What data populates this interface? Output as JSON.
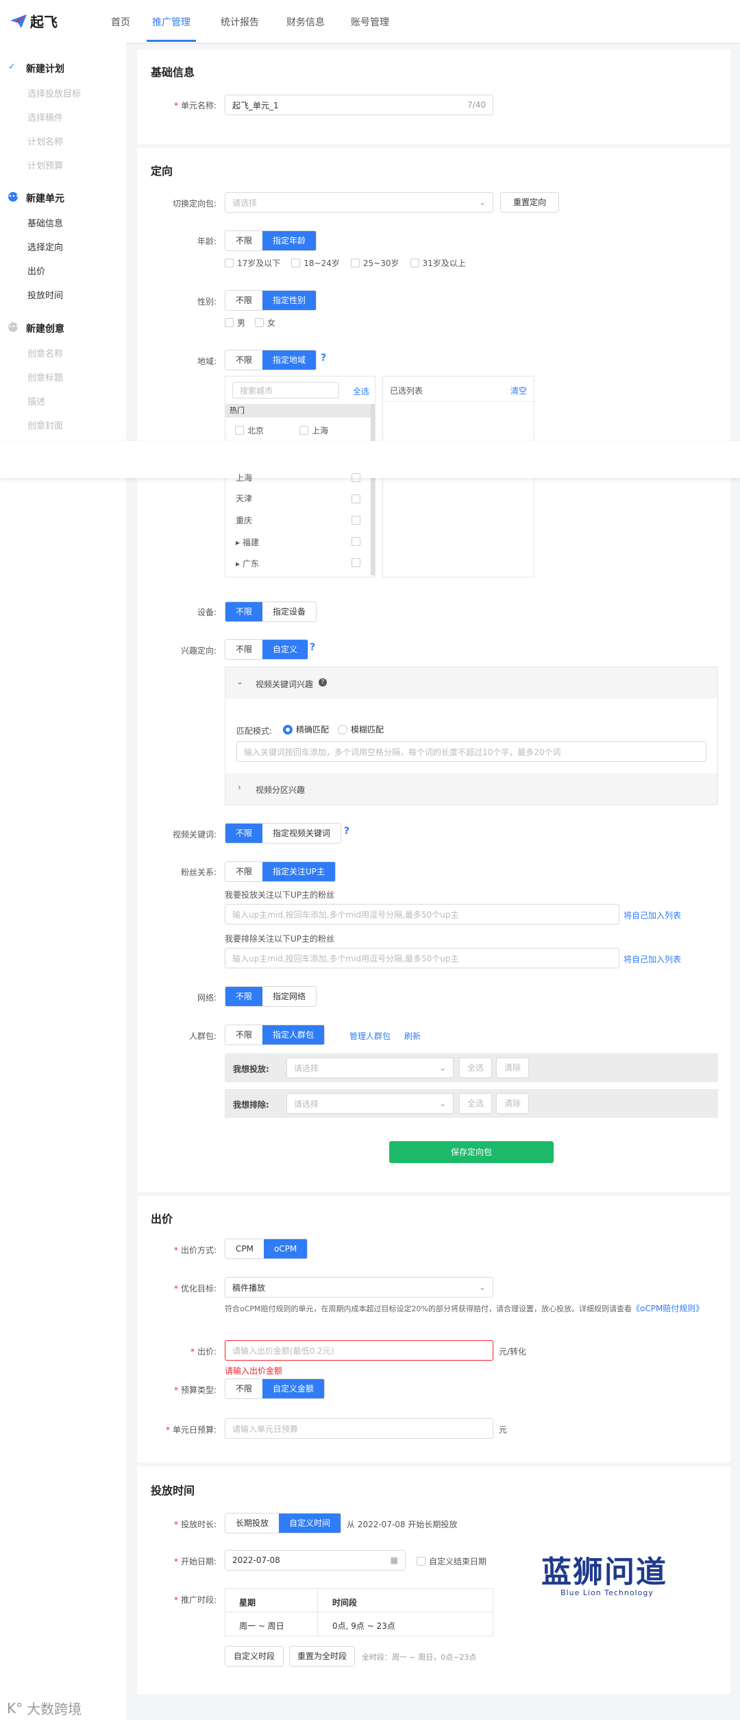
{
  "nav": {
    "logo": "起飞",
    "items": [
      "首页",
      "推广管理",
      "统计报告",
      "财务信息",
      "账号管理"
    ]
  },
  "sidebar": {
    "plan": {
      "title": "新建计划",
      "items": [
        "选择投放目标",
        "选择稿件",
        "计划名称",
        "计划预算"
      ]
    },
    "unit": {
      "title": "新建单元",
      "items": [
        "基础信息",
        "选择定向",
        "出价",
        "投放时间"
      ]
    },
    "creative": {
      "title": "新建创意",
      "items": [
        "创意名称",
        "创意标题",
        "描述",
        "创意封面"
      ]
    }
  },
  "basic": {
    "title": "基础信息",
    "unit_label": "单元名称:",
    "unit_value": "起飞_单元_1",
    "unit_count": "7/40"
  },
  "target": {
    "title": "定向",
    "switch_label": "切换定向包:",
    "switch_ph": "请选择",
    "reset": "重置定向",
    "age_label": "年龄:",
    "age_opts": [
      "不限",
      "指定年龄"
    ],
    "age_checks": [
      "17岁及以下",
      "18~24岁",
      "25~30岁",
      "31岁及以上"
    ],
    "gender_label": "性别:",
    "gender_opts": [
      "不限",
      "指定性别"
    ],
    "gender_checks": [
      "男",
      "女"
    ],
    "region_label": "地域:",
    "region_opts": [
      "不限",
      "指定地域"
    ],
    "q": "?",
    "search_ph": "搜索城市",
    "select_all": "全选",
    "hot": "热门",
    "hot_cities": [
      "北京",
      "上海"
    ],
    "selected": "已选列表",
    "clear": "清空",
    "cities": [
      "上海",
      "天津",
      "重庆",
      "福建",
      "广东"
    ],
    "device_label": "设备:",
    "device_opts": [
      "不限",
      "指定设备"
    ],
    "interest_label": "兴趣定向:",
    "interest_opts": [
      "不限",
      "自定义"
    ],
    "kw_interest": "视频关键词兴趣",
    "match_label": "匹配模式:",
    "match_opts": [
      "精确匹配",
      "模糊匹配"
    ],
    "kw_ph": "输入关键词按回车添加，多个词用空格分隔，每个词的长度不超过10个字，最多20个词",
    "zone_interest": "视频分区兴趣",
    "video_kw_label": "视频关键词:",
    "video_kw_opts": [
      "不限",
      "指定视频关键词"
    ],
    "fans_label": "粉丝关系:",
    "fans_opts": [
      "不限",
      "指定关注UP主"
    ],
    "fans_inc": "我要投放关注以下UP主的粉丝",
    "fans_exc": "我要排除关注以下UP主的粉丝",
    "fans_ph": "输入up主mid,按回车添加,多个mid用逗号分隔,最多50个up主",
    "add_self": "将自己加入列表",
    "net_label": "网络:",
    "net_opts": [
      "不限",
      "指定网络"
    ],
    "crowd_label": "人群包:",
    "crowd_opts": [
      "不限",
      "指定人群包"
    ],
    "manage": "管理人群包",
    "refresh": "刷新",
    "want_put": "我想投放:",
    "want_exc": "我想排除:",
    "choose_ph": "请选择",
    "all": "全选",
    "clr": "清除",
    "save": "保存定向包"
  },
  "bid": {
    "title": "出价",
    "mode_label": "出价方式:",
    "mode_opts": [
      "CPM",
      "oCPM"
    ],
    "goal_label": "优化目标:",
    "goal_value": "稿件播放",
    "note": "符合oCPM赔付规则的单元，在周期内成本超过目标设定20%的部分将获得赔付，请合理设置，放心投放。详细规则请查看",
    "note_link": "《oCPM赔付规则》",
    "price_label": "出价:",
    "price_ph": "请输入出价金额(最低0.2元)",
    "price_unit": "元/转化",
    "price_err": "请输入出价金额",
    "budget_type_label": "预算类型:",
    "budget_type_opts": [
      "不限",
      "自定义金额"
    ],
    "daily_label": "单元日预算:",
    "daily_ph": "请输入单元日预算",
    "daily_unit": "元"
  },
  "schedule": {
    "title": "投放时间",
    "dur_label": "投放时长:",
    "dur_opts": [
      "长期投放",
      "自定义时间"
    ],
    "dur_note": "从 2022-07-08 开始长期投放",
    "start_label": "开始日期:",
    "start_value": "2022-07-08",
    "end_chk": "自定义结束日期",
    "period_label": "推广时段:",
    "th_week": "星期",
    "th_time": "时间段",
    "td_week": "周一 ~ 周日",
    "td_time": "0点, 9点 ~ 23点",
    "custom": "自定义时段",
    "reset_all": "重置为全时段",
    "summary": "全时段：周一 ~ 周日，0点~23点"
  },
  "watermark": {
    "brand": "蓝狮问道",
    "sub": "Blue Lion Technology",
    "corner": "大数跨境"
  },
  "colors": {
    "accent": "#2f7cf6",
    "save": "#1db96a",
    "error": "#f5222d"
  }
}
